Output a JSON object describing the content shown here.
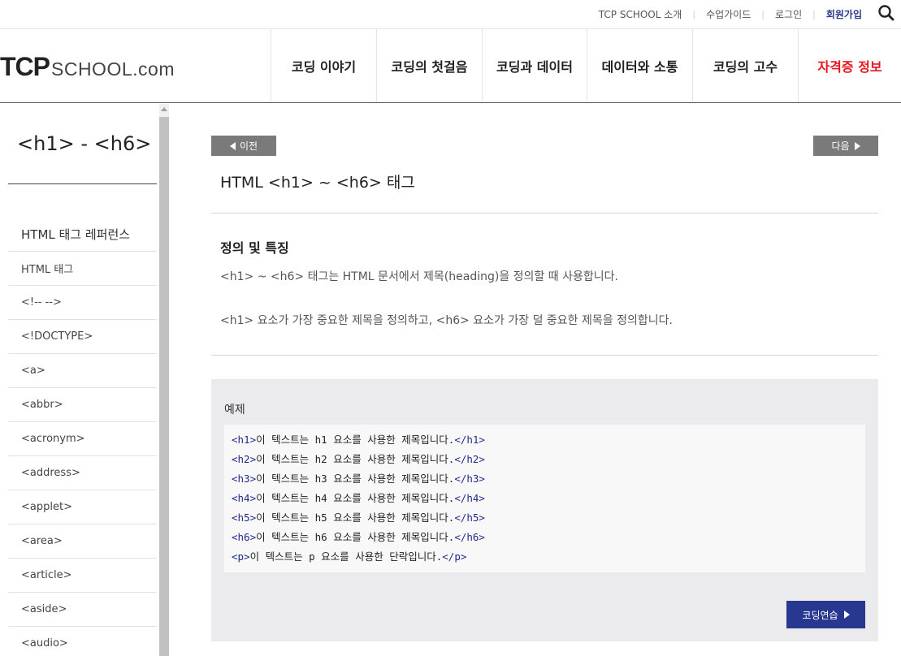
{
  "util_bar": {
    "links": [
      {
        "label": "TCP SCHOOL 소개",
        "strong": false
      },
      {
        "label": "수업가이드",
        "strong": false
      },
      {
        "label": "로그인",
        "strong": false
      },
      {
        "label": "회원가입",
        "strong": true
      }
    ],
    "search_icon": "search-icon"
  },
  "logo": {
    "tcp": "TCP",
    "school": "SCHOOL.com"
  },
  "gnb": {
    "items": [
      {
        "label": "코딩 이야기",
        "hot": false
      },
      {
        "label": "코딩의 첫걸음",
        "hot": false
      },
      {
        "label": "코딩과 데이터",
        "hot": false
      },
      {
        "label": "데이터와 소통",
        "hot": false
      },
      {
        "label": "코딩의 고수",
        "hot": false
      },
      {
        "label": "자격증 정보",
        "hot": true
      }
    ],
    "hot_color": "#e8171f"
  },
  "sidebar": {
    "title": "<h1> - <h6>",
    "items": [
      "HTML 태그 레퍼런스",
      "HTML 태그",
      "<!-- -->",
      "<!DOCTYPE>",
      "<a>",
      "<abbr>",
      "<acronym>",
      "<address>",
      "<applet>",
      "<area>",
      "<article>",
      "<aside>",
      "<audio>"
    ]
  },
  "nav": {
    "prev": "이전",
    "next": "다음"
  },
  "main": {
    "title": "HTML <h1> ~ <h6> 태그",
    "section_title": "정의 및 특징",
    "paragraphs": [
      "<h1> ~ <h6> 태그는 HTML 문서에서 제목(heading)을 정의할 때 사용합니다.",
      "<h1> 요소가 가장 중요한 제목을 정의하고, <h6> 요소가 가장 덜 중요한 제목을 정의합니다."
    ]
  },
  "example": {
    "label": "예제",
    "lines": [
      {
        "open": "<h1>",
        "text": "이 텍스트는 h1 요소를 사용한 제목입니다.",
        "close": "</h1>"
      },
      {
        "open": "<h2>",
        "text": "이 텍스트는 h2 요소를 사용한 제목입니다.",
        "close": "</h2>"
      },
      {
        "open": "<h3>",
        "text": "이 텍스트는 h3 요소를 사용한 제목입니다.",
        "close": "</h3>"
      },
      {
        "open": "<h4>",
        "text": "이 텍스트는 h4 요소를 사용한 제목입니다.",
        "close": "</h4>"
      },
      {
        "open": "<h5>",
        "text": "이 텍스트는 h5 요소를 사용한 제목입니다.",
        "close": "</h5>"
      },
      {
        "open": "<h6>",
        "text": "이 텍스트는 h6 요소를 사용한 제목입니다.",
        "close": "</h6>"
      },
      {
        "open": "<p>",
        "text": "이 텍스트는 p 요소를 사용한 단락입니다.",
        "close": "</p>"
      }
    ],
    "practice_button": "코딩연습",
    "accent_color": "#283790"
  }
}
